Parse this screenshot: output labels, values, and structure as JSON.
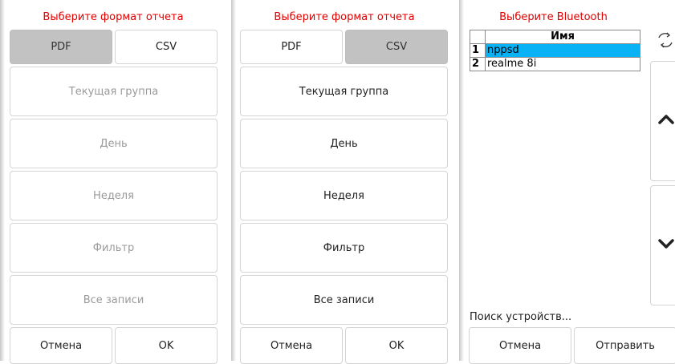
{
  "panel1": {
    "title": "Выберите формат отчета",
    "format_pdf": "PDF",
    "format_csv": "CSV",
    "options": [
      "Текущая группа",
      "День",
      "Неделя",
      "Фильтр",
      "Все записи"
    ],
    "cancel": "Отмена",
    "ok": "OK"
  },
  "panel2": {
    "title": "Выберите формат отчета",
    "format_pdf": "PDF",
    "format_csv": "CSV",
    "options": [
      "Текущая группа",
      "День",
      "Неделя",
      "Фильтр",
      "Все записи"
    ],
    "cancel": "Отмена",
    "ok": "OK"
  },
  "panel3": {
    "title": "Выберите Bluetooth",
    "column_header": "Имя",
    "devices": [
      {
        "index": "1",
        "name": "nppsd"
      },
      {
        "index": "2",
        "name": "realme 8i"
      }
    ],
    "status": "Поиск устройств...",
    "cancel": "Отмена",
    "send": "Отправить",
    "icons": {
      "refresh": "refresh-icon",
      "up": "chevron-up-icon",
      "down": "chevron-down-icon"
    }
  },
  "colors": {
    "title": "#e00000",
    "selected_row": "#09b1f5",
    "selected_button": "#c2c2c2"
  }
}
